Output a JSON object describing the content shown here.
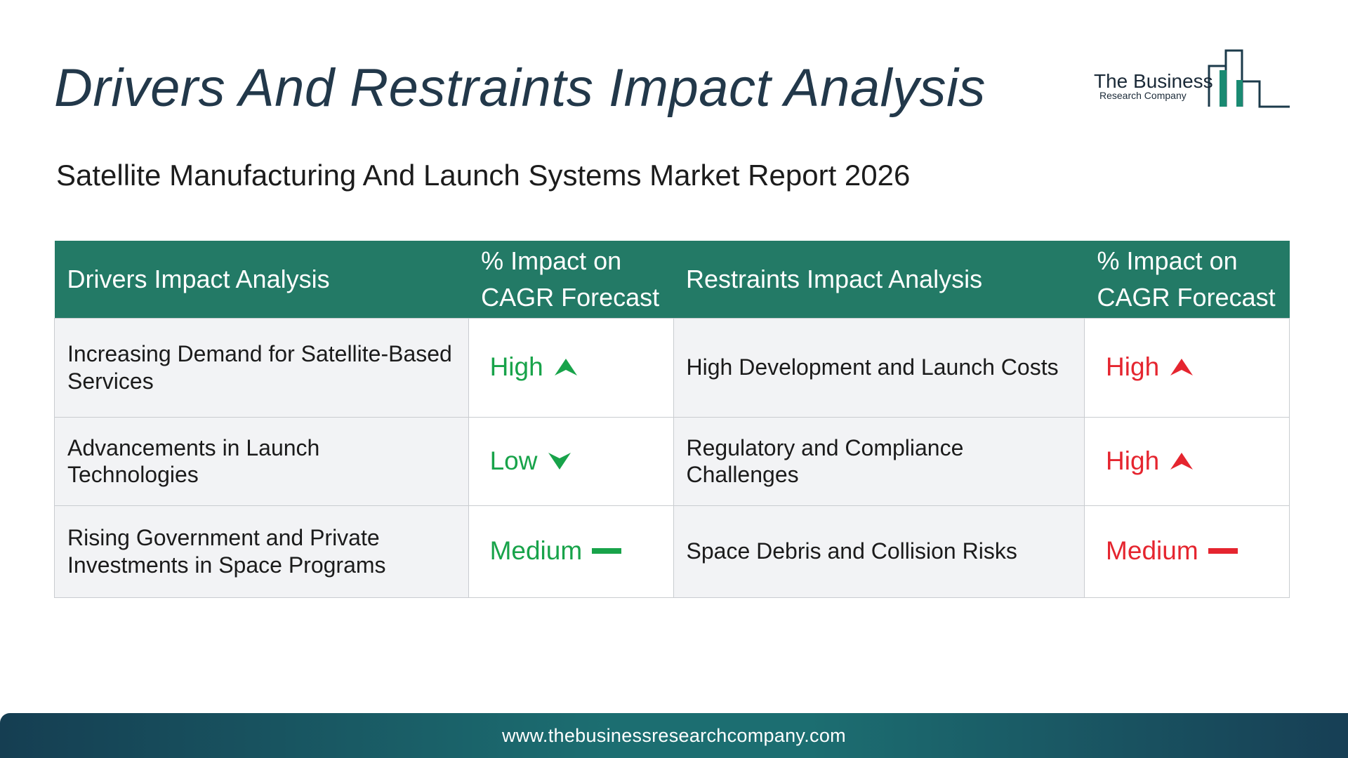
{
  "header": {
    "title": "Drivers And Restraints Impact Analysis",
    "subtitle": "Satellite Manufacturing And Launch Systems Market Report 2026"
  },
  "logo": {
    "line1": "The Business",
    "line2": "Research Company",
    "color": "#1a8a72"
  },
  "table": {
    "headers": {
      "drivers": "Drivers Impact Analysis",
      "drivers_impact": "% Impact on CAGR Forecast",
      "restraints": "Restraints Impact Analysis",
      "restraints_impact": "% Impact on CAGR Forecast"
    },
    "header_color": "#237a66",
    "rows": [
      {
        "driver": "Increasing Demand for Satellite-Based Services",
        "driver_impact": "High",
        "driver_icon": "arrow-up-icon",
        "restraint": "High Development and Launch Costs",
        "restraint_impact": "High",
        "restraint_icon": "arrow-up-icon"
      },
      {
        "driver": "Advancements in Launch Technologies",
        "driver_impact": "Low",
        "driver_icon": "arrow-down-icon",
        "restraint": "Regulatory and Compliance Challenges",
        "restraint_impact": "High",
        "restraint_icon": "arrow-up-icon"
      },
      {
        "driver": "Rising Government and Private Investments in Space Programs",
        "driver_impact": "Medium",
        "driver_icon": "dash-icon",
        "restraint": "Space Debris and Collision Risks",
        "restraint_impact": "Medium",
        "restraint_icon": "dash-icon"
      }
    ],
    "driver_color": "#18a34a",
    "restraint_color": "#e5252f"
  },
  "footer": {
    "url": "www.thebusinessresearchcompany.com"
  }
}
